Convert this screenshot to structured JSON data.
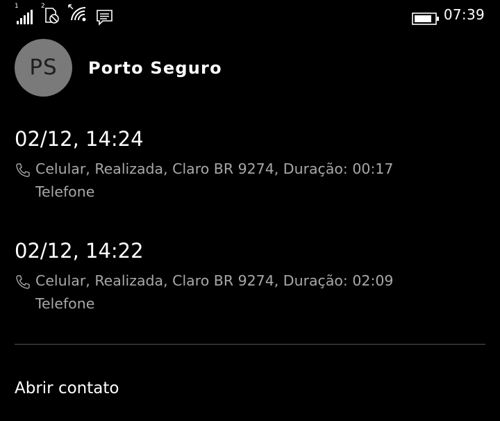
{
  "status_bar": {
    "sim1_label": "1",
    "sim2_label": "2",
    "time": "07:39",
    "icons": [
      "signal-bars-icon",
      "sim2-no-signal-icon",
      "wifi-icon",
      "message-icon",
      "battery-icon"
    ]
  },
  "contact": {
    "initials": "PS",
    "name": "Porto Seguro"
  },
  "calls": [
    {
      "datetime": "02/12, 14:24",
      "detail": "Celular, Realizada, Claro BR 9274, Duração: 00:17",
      "source": "Telefone"
    },
    {
      "datetime": "02/12, 14:22",
      "detail": "Celular, Realizada, Claro BR 9274, Duração: 02:09",
      "source": "Telefone"
    }
  ],
  "actions": {
    "open_contact": "Abrir contato"
  },
  "colors": {
    "background": "#000000",
    "avatar": "#7a7a7a",
    "secondary_text": "#a8a8a8"
  }
}
